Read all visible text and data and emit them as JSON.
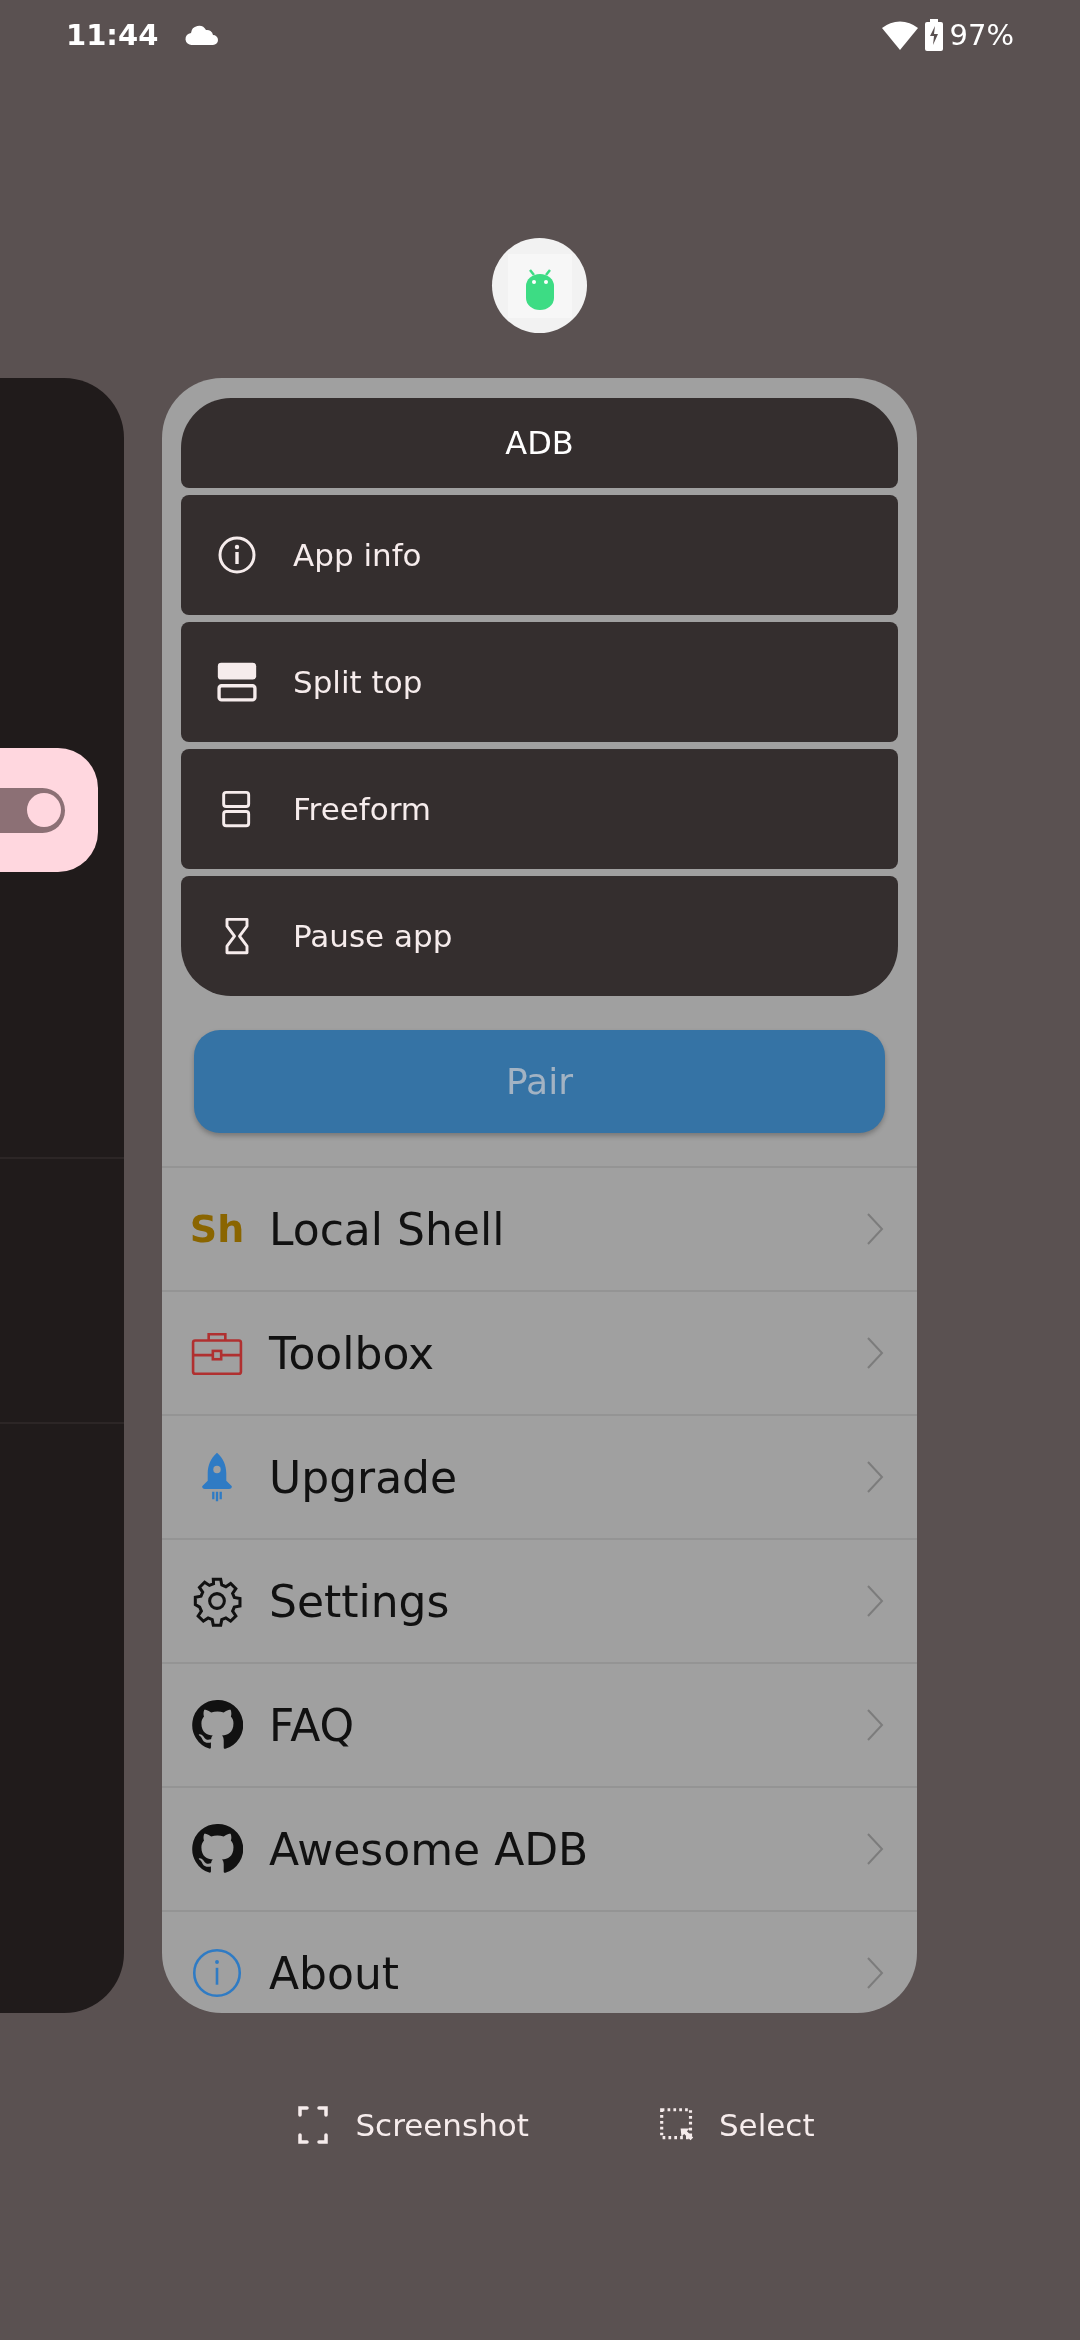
{
  "status_bar": {
    "time": "11:44",
    "battery": "97%"
  },
  "side_card": {
    "toggle": {
      "on": true
    }
  },
  "app": {
    "menu_title": "ADB",
    "menu_items": [
      {
        "kind": "info",
        "label": "App info"
      },
      {
        "kind": "split",
        "label": "Split top"
      },
      {
        "kind": "freeform",
        "label": "Freeform"
      },
      {
        "kind": "pause",
        "label": "Pause app"
      }
    ],
    "pair_button": "Pair",
    "list_items": [
      {
        "kind": "shell",
        "icon_text": "Sh",
        "label": "Local Shell"
      },
      {
        "kind": "toolbox",
        "label": "Toolbox"
      },
      {
        "kind": "rocket",
        "label": "Upgrade"
      },
      {
        "kind": "gear",
        "label": "Settings"
      },
      {
        "kind": "github",
        "label": "FAQ"
      },
      {
        "kind": "github",
        "label": "Awesome ADB"
      },
      {
        "kind": "info",
        "label": "About"
      }
    ]
  },
  "actions": [
    {
      "kind": "screenshot",
      "label": "Screenshot"
    },
    {
      "kind": "select",
      "label": "Select"
    }
  ]
}
